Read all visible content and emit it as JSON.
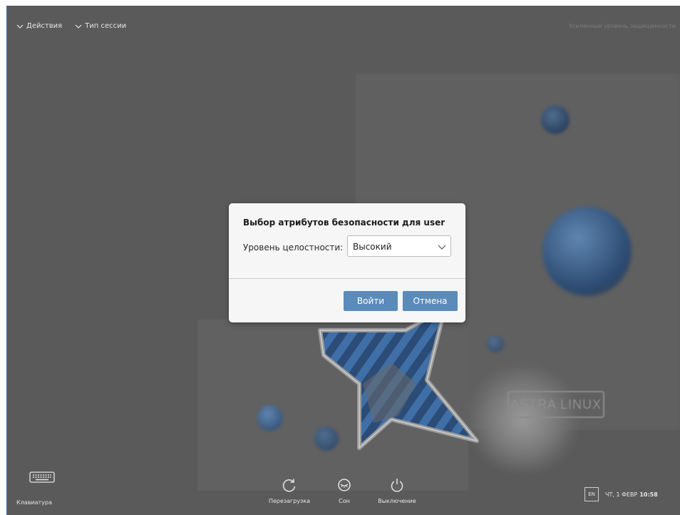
{
  "topbar": {
    "actions_label": "Действия",
    "session_type_label": "Тип сессии",
    "security_level_label": "Усиленный уровень защищенности"
  },
  "dialog": {
    "title": "Выбор атрибутов безопасности для user",
    "integrity_label": "Уровень целостности:",
    "integrity_value": "Высокий",
    "login_button": "Войти",
    "cancel_button": "Отмена"
  },
  "bottombar": {
    "keyboard_label": "Клавиатура",
    "restart_label": "Перезагрузка",
    "sleep_label": "Сон",
    "shutdown_label": "Выключение",
    "language": "EN",
    "date": "ЧТ, 1 ФЕВР",
    "time": "10:58"
  },
  "wallpaper": {
    "brand_text": "ASTRA LINUX"
  },
  "colors": {
    "background": "#5a5a5a",
    "accent": "#5b8bb8",
    "dialog_bg": "#f6f6f6"
  },
  "icons": {
    "actions_chevron": "chevron-down-icon",
    "session_chevron": "chevron-down-icon",
    "select_arrow": "chevron-down-icon",
    "keyboard": "keyboard-icon",
    "restart": "restart-icon",
    "sleep": "sleep-icon",
    "shutdown": "power-icon"
  }
}
